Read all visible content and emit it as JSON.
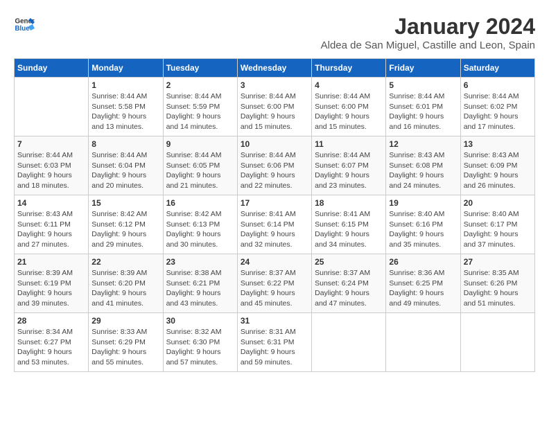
{
  "header": {
    "logo_line1": "General",
    "logo_line2": "Blue",
    "month_title": "January 2024",
    "location": "Aldea de San Miguel, Castille and Leon, Spain"
  },
  "calendar": {
    "days_of_week": [
      "Sunday",
      "Monday",
      "Tuesday",
      "Wednesday",
      "Thursday",
      "Friday",
      "Saturday"
    ],
    "weeks": [
      [
        {
          "day": "",
          "content": ""
        },
        {
          "day": "1",
          "content": "Sunrise: 8:44 AM\nSunset: 5:58 PM\nDaylight: 9 hours\nand 13 minutes."
        },
        {
          "day": "2",
          "content": "Sunrise: 8:44 AM\nSunset: 5:59 PM\nDaylight: 9 hours\nand 14 minutes."
        },
        {
          "day": "3",
          "content": "Sunrise: 8:44 AM\nSunset: 6:00 PM\nDaylight: 9 hours\nand 15 minutes."
        },
        {
          "day": "4",
          "content": "Sunrise: 8:44 AM\nSunset: 6:00 PM\nDaylight: 9 hours\nand 15 minutes."
        },
        {
          "day": "5",
          "content": "Sunrise: 8:44 AM\nSunset: 6:01 PM\nDaylight: 9 hours\nand 16 minutes."
        },
        {
          "day": "6",
          "content": "Sunrise: 8:44 AM\nSunset: 6:02 PM\nDaylight: 9 hours\nand 17 minutes."
        }
      ],
      [
        {
          "day": "7",
          "content": "Sunrise: 8:44 AM\nSunset: 6:03 PM\nDaylight: 9 hours\nand 18 minutes."
        },
        {
          "day": "8",
          "content": "Sunrise: 8:44 AM\nSunset: 6:04 PM\nDaylight: 9 hours\nand 20 minutes."
        },
        {
          "day": "9",
          "content": "Sunrise: 8:44 AM\nSunset: 6:05 PM\nDaylight: 9 hours\nand 21 minutes."
        },
        {
          "day": "10",
          "content": "Sunrise: 8:44 AM\nSunset: 6:06 PM\nDaylight: 9 hours\nand 22 minutes."
        },
        {
          "day": "11",
          "content": "Sunrise: 8:44 AM\nSunset: 6:07 PM\nDaylight: 9 hours\nand 23 minutes."
        },
        {
          "day": "12",
          "content": "Sunrise: 8:43 AM\nSunset: 6:08 PM\nDaylight: 9 hours\nand 24 minutes."
        },
        {
          "day": "13",
          "content": "Sunrise: 8:43 AM\nSunset: 6:09 PM\nDaylight: 9 hours\nand 26 minutes."
        }
      ],
      [
        {
          "day": "14",
          "content": "Sunrise: 8:43 AM\nSunset: 6:11 PM\nDaylight: 9 hours\nand 27 minutes."
        },
        {
          "day": "15",
          "content": "Sunrise: 8:42 AM\nSunset: 6:12 PM\nDaylight: 9 hours\nand 29 minutes."
        },
        {
          "day": "16",
          "content": "Sunrise: 8:42 AM\nSunset: 6:13 PM\nDaylight: 9 hours\nand 30 minutes."
        },
        {
          "day": "17",
          "content": "Sunrise: 8:41 AM\nSunset: 6:14 PM\nDaylight: 9 hours\nand 32 minutes."
        },
        {
          "day": "18",
          "content": "Sunrise: 8:41 AM\nSunset: 6:15 PM\nDaylight: 9 hours\nand 34 minutes."
        },
        {
          "day": "19",
          "content": "Sunrise: 8:40 AM\nSunset: 6:16 PM\nDaylight: 9 hours\nand 35 minutes."
        },
        {
          "day": "20",
          "content": "Sunrise: 8:40 AM\nSunset: 6:17 PM\nDaylight: 9 hours\nand 37 minutes."
        }
      ],
      [
        {
          "day": "21",
          "content": "Sunrise: 8:39 AM\nSunset: 6:19 PM\nDaylight: 9 hours\nand 39 minutes."
        },
        {
          "day": "22",
          "content": "Sunrise: 8:39 AM\nSunset: 6:20 PM\nDaylight: 9 hours\nand 41 minutes."
        },
        {
          "day": "23",
          "content": "Sunrise: 8:38 AM\nSunset: 6:21 PM\nDaylight: 9 hours\nand 43 minutes."
        },
        {
          "day": "24",
          "content": "Sunrise: 8:37 AM\nSunset: 6:22 PM\nDaylight: 9 hours\nand 45 minutes."
        },
        {
          "day": "25",
          "content": "Sunrise: 8:37 AM\nSunset: 6:24 PM\nDaylight: 9 hours\nand 47 minutes."
        },
        {
          "day": "26",
          "content": "Sunrise: 8:36 AM\nSunset: 6:25 PM\nDaylight: 9 hours\nand 49 minutes."
        },
        {
          "day": "27",
          "content": "Sunrise: 8:35 AM\nSunset: 6:26 PM\nDaylight: 9 hours\nand 51 minutes."
        }
      ],
      [
        {
          "day": "28",
          "content": "Sunrise: 8:34 AM\nSunset: 6:27 PM\nDaylight: 9 hours\nand 53 minutes."
        },
        {
          "day": "29",
          "content": "Sunrise: 8:33 AM\nSunset: 6:29 PM\nDaylight: 9 hours\nand 55 minutes."
        },
        {
          "day": "30",
          "content": "Sunrise: 8:32 AM\nSunset: 6:30 PM\nDaylight: 9 hours\nand 57 minutes."
        },
        {
          "day": "31",
          "content": "Sunrise: 8:31 AM\nSunset: 6:31 PM\nDaylight: 9 hours\nand 59 minutes."
        },
        {
          "day": "",
          "content": ""
        },
        {
          "day": "",
          "content": ""
        },
        {
          "day": "",
          "content": ""
        }
      ]
    ]
  }
}
